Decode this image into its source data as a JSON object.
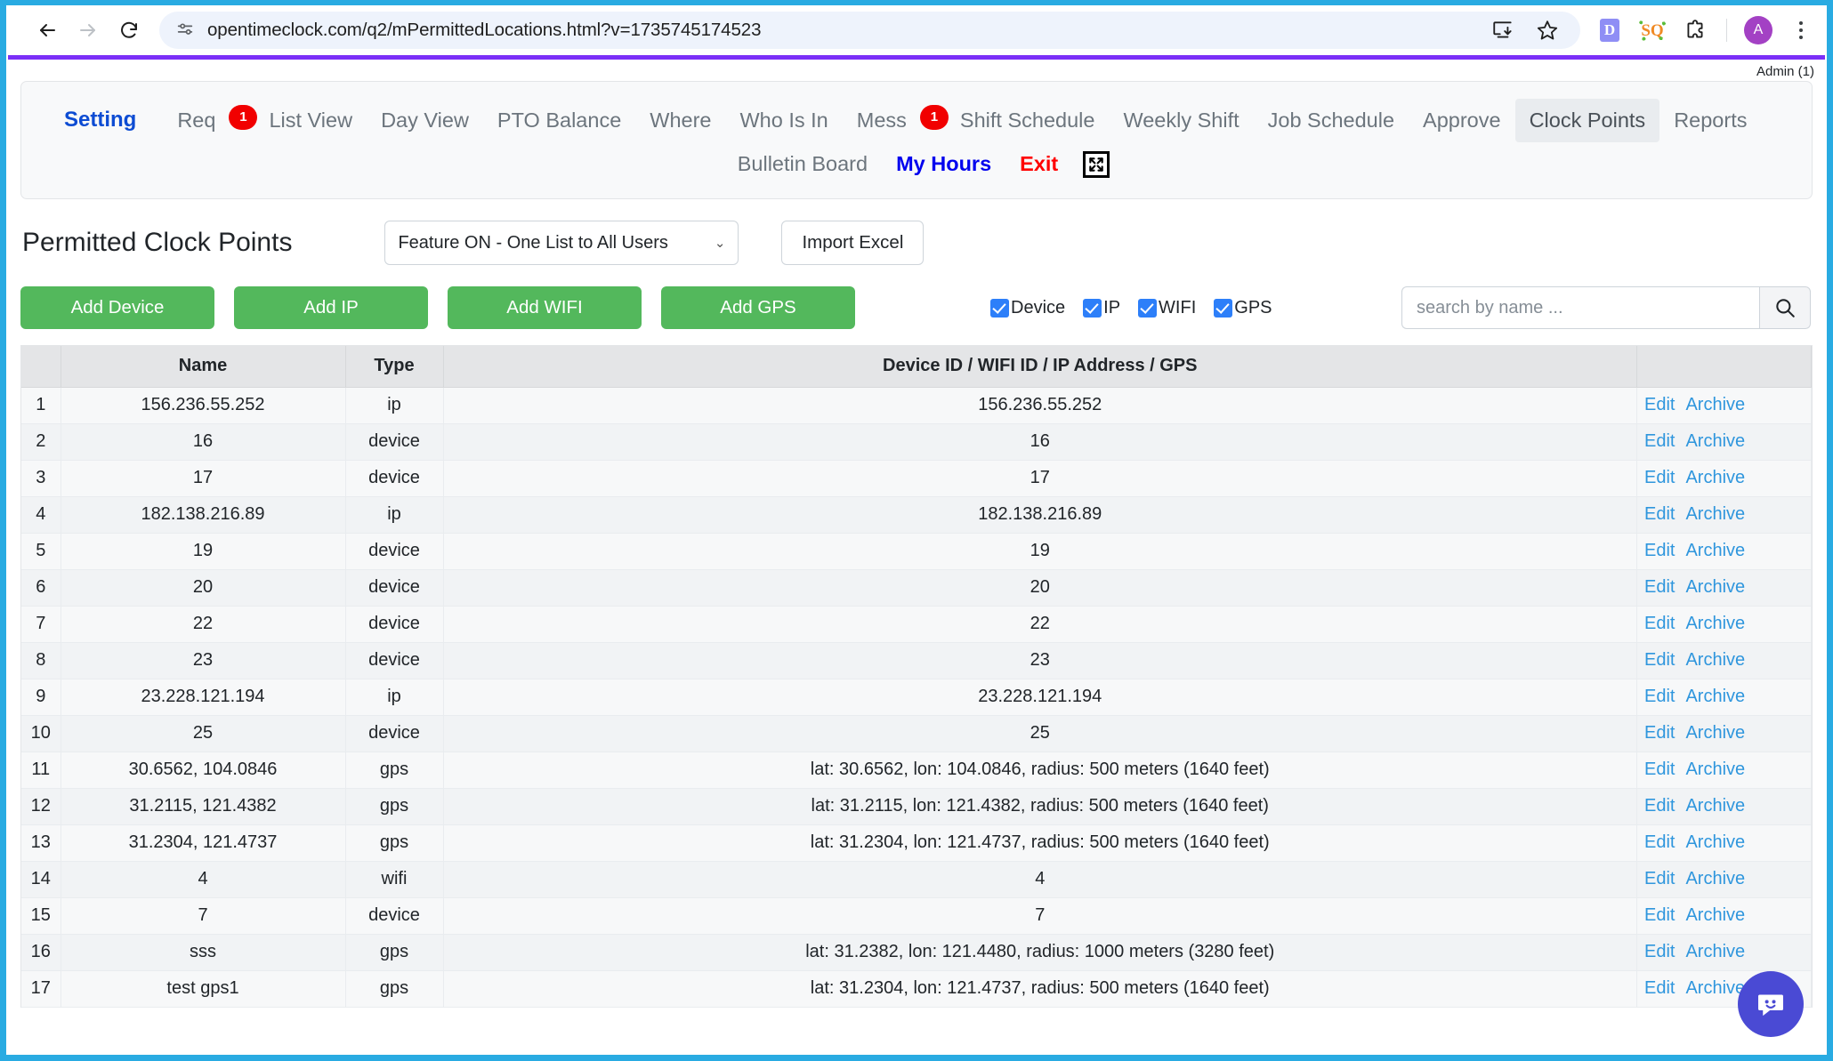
{
  "browser": {
    "url": "opentimeclock.com/q2/mPermittedLocations.html?v=1735745174523",
    "back_label": "←",
    "forward_label": "→",
    "reload_label": "⟳",
    "avatar_initial": "A",
    "ext_d_label": "D",
    "ext_sq_label": "SQ"
  },
  "app": {
    "admin_label": "Admin (1)",
    "nav_row1": [
      {
        "label": "Setting",
        "style": "brand",
        "badge": null
      },
      {
        "label": "Req",
        "style": "normal",
        "badge": "1"
      },
      {
        "label": "List View",
        "style": "normal",
        "badge": null
      },
      {
        "label": "Day View",
        "style": "normal",
        "badge": null
      },
      {
        "label": "PTO Balance",
        "style": "normal",
        "badge": null
      },
      {
        "label": "Where",
        "style": "normal",
        "badge": null
      },
      {
        "label": "Who Is In",
        "style": "normal",
        "badge": null
      },
      {
        "label": "Mess",
        "style": "normal",
        "badge": "1"
      },
      {
        "label": "Shift Schedule",
        "style": "normal",
        "badge": null
      },
      {
        "label": "Weekly Shift",
        "style": "normal",
        "badge": null
      },
      {
        "label": "Job Schedule",
        "style": "normal",
        "badge": null
      },
      {
        "label": "Approve",
        "style": "normal",
        "badge": null
      },
      {
        "label": "Clock Points",
        "style": "active",
        "badge": null
      },
      {
        "label": "Reports",
        "style": "normal",
        "badge": null
      }
    ],
    "nav_row2": [
      {
        "label": "Bulletin Board",
        "style": "normal"
      },
      {
        "label": "My Hours",
        "style": "blue"
      },
      {
        "label": "Exit",
        "style": "red"
      }
    ]
  },
  "toolbar": {
    "page_title": "Permitted Clock Points",
    "feature_select_value": "Feature ON - One List to All Users",
    "import_label": "Import Excel",
    "buttons": [
      "Add Device",
      "Add IP",
      "Add WIFI",
      "Add GPS"
    ],
    "checkboxes": [
      "Device",
      "IP",
      "WIFI",
      "GPS"
    ],
    "search_placeholder": "search by name ...",
    "search_value": ""
  },
  "table": {
    "headers": [
      "",
      "Name",
      "Type",
      "Device ID / WIFI ID / IP Address / GPS",
      ""
    ],
    "edit_label": "Edit",
    "archive_label": "Archive",
    "rows": [
      {
        "idx": "1",
        "name": "156.236.55.252",
        "type": "ip",
        "detail": "156.236.55.252"
      },
      {
        "idx": "2",
        "name": "16",
        "type": "device",
        "detail": "16"
      },
      {
        "idx": "3",
        "name": "17",
        "type": "device",
        "detail": "17"
      },
      {
        "idx": "4",
        "name": "182.138.216.89",
        "type": "ip",
        "detail": "182.138.216.89"
      },
      {
        "idx": "5",
        "name": "19",
        "type": "device",
        "detail": "19"
      },
      {
        "idx": "6",
        "name": "20",
        "type": "device",
        "detail": "20"
      },
      {
        "idx": "7",
        "name": "22",
        "type": "device",
        "detail": "22"
      },
      {
        "idx": "8",
        "name": "23",
        "type": "device",
        "detail": "23"
      },
      {
        "idx": "9",
        "name": "23.228.121.194",
        "type": "ip",
        "detail": "23.228.121.194"
      },
      {
        "idx": "10",
        "name": "25",
        "type": "device",
        "detail": "25"
      },
      {
        "idx": "11",
        "name": "30.6562, 104.0846",
        "type": "gps",
        "detail": "lat: 30.6562, lon: 104.0846, radius: 500 meters (1640 feet)"
      },
      {
        "idx": "12",
        "name": "31.2115, 121.4382",
        "type": "gps",
        "detail": "lat: 31.2115, lon: 121.4382, radius: 500 meters (1640 feet)"
      },
      {
        "idx": "13",
        "name": "31.2304, 121.4737",
        "type": "gps",
        "detail": "lat: 31.2304, lon: 121.4737, radius: 500 meters (1640 feet)"
      },
      {
        "idx": "14",
        "name": "4",
        "type": "wifi",
        "detail": "4"
      },
      {
        "idx": "15",
        "name": "7",
        "type": "device",
        "detail": "7"
      },
      {
        "idx": "16",
        "name": "sss",
        "type": "gps",
        "detail": "lat: 31.2382, lon: 121.4480, radius: 1000 meters (3280 feet)"
      },
      {
        "idx": "17",
        "name": "test gps1",
        "type": "gps",
        "detail": "lat: 31.2304, lon: 121.4737, radius: 500 meters (1640 feet)"
      }
    ]
  },
  "colors": {
    "accent_purple": "#7b2ff7",
    "green_button": "#53b85c",
    "link_blue": "#2f96dd",
    "badge_red": "#f10000",
    "frame_blue": "#29ABE2"
  }
}
